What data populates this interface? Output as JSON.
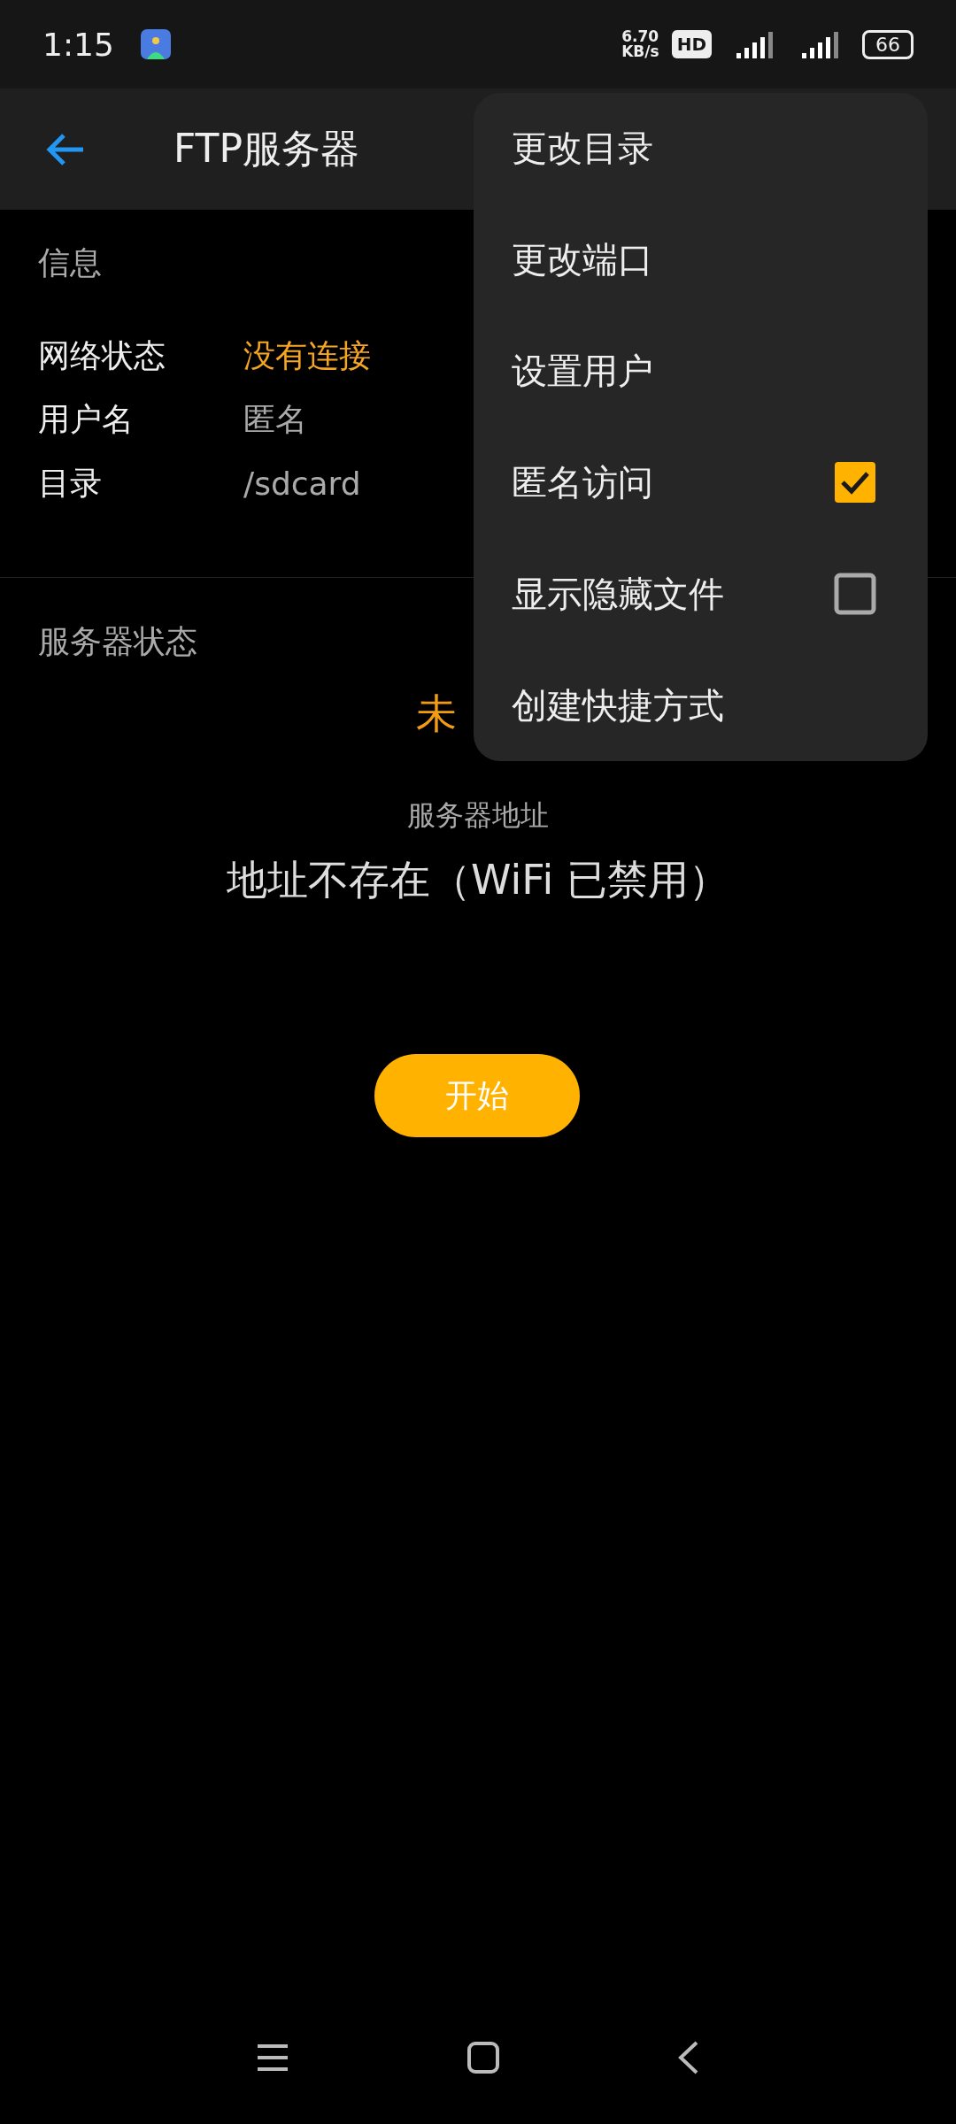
{
  "status_bar": {
    "time": "1:15",
    "speed": "6.70\nKB/s",
    "hd": "HD",
    "battery": "66"
  },
  "app_bar": {
    "title": "FTP服务器"
  },
  "info": {
    "heading": "信息",
    "rows": [
      {
        "label": "网络状态",
        "value": "没有连接",
        "kind": "warning"
      },
      {
        "label": "用户名",
        "value": "匿名",
        "kind": "plain"
      },
      {
        "label": "目录",
        "value": "/sdcard",
        "kind": "plain"
      }
    ]
  },
  "server": {
    "heading": "服务器状态",
    "state": "未",
    "address_label": "服务器地址",
    "address": "地址不存在（WiFi 已禁用）",
    "start_button": "开始"
  },
  "menu": {
    "items": [
      {
        "label": "更改目录",
        "kind": "action"
      },
      {
        "label": "更改端口",
        "kind": "action"
      },
      {
        "label": "设置用户",
        "kind": "action"
      },
      {
        "label": "匿名访问",
        "kind": "check",
        "checked": true
      },
      {
        "label": "显示隐藏文件",
        "kind": "check",
        "checked": false
      },
      {
        "label": "创建快捷方式",
        "kind": "action"
      }
    ]
  }
}
